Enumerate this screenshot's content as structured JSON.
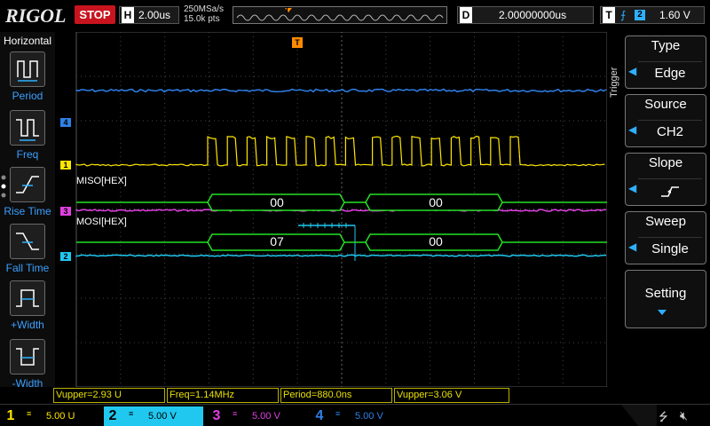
{
  "header": {
    "brand": "RIGOL",
    "run_state": "STOP",
    "timebase_label": "H",
    "timebase_value": "2.00us",
    "sample_rate": "250MSa/s",
    "memory_depth": "15.0k pts",
    "delay_label": "D",
    "delay_value": "2.00000000us",
    "trigger_label": "T",
    "trigger_channel": "2",
    "trigger_level": "1.60 V"
  },
  "left_menu": {
    "title": "Horizontal",
    "items": [
      {
        "label": "Period",
        "icon": "period-measure-icon"
      },
      {
        "label": "Freq",
        "icon": "frequency-measure-icon"
      },
      {
        "label": "Rise Time",
        "icon": "rise-time-measure-icon"
      },
      {
        "label": "Fall Time",
        "icon": "fall-time-measure-icon"
      },
      {
        "label": "+Width",
        "icon": "positive-width-measure-icon"
      },
      {
        "label": "-Width",
        "icon": "negative-width-measure-icon"
      }
    ]
  },
  "right_menu": {
    "side_label": "Trigger",
    "items": [
      {
        "head": "Type",
        "value": "Edge"
      },
      {
        "head": "Source",
        "value": "CH2"
      },
      {
        "head": "Slope",
        "value": "",
        "icon": "rising-edge-icon"
      },
      {
        "head": "Sweep",
        "value": "Single"
      },
      {
        "head": "Setting",
        "value": ""
      }
    ]
  },
  "decode": {
    "miso_label": "MISO[HEX]",
    "mosi_label": "MOSI[HEX]",
    "miso_frames": [
      "00",
      "00"
    ],
    "mosi_frames": [
      "07",
      "00"
    ]
  },
  "markers": {
    "ch4": "4",
    "ch1": "1",
    "ch3": "3",
    "ch2": "2",
    "trigger": "T"
  },
  "measurements": [
    {
      "text": "Vupper=2.93 U"
    },
    {
      "text": "Freq=1.14MHz"
    },
    {
      "text": "Period=880.0ns"
    },
    {
      "text": "Vupper=3.06 V"
    }
  ],
  "channels": [
    {
      "num": "1",
      "scale": "5.00 U",
      "color": "#ffe600"
    },
    {
      "num": "2",
      "scale": "5.00 V",
      "color": "#2fd8ff"
    },
    {
      "num": "3",
      "scale": "5.00 V",
      "color": "#e040e0"
    },
    {
      "num": "4",
      "scale": "5.00 V",
      "color": "#2080ff"
    }
  ],
  "colors": {
    "ch1": "#ffe600",
    "ch2": "#20c8f0",
    "ch3": "#e040e0",
    "ch4": "#2e80e8",
    "decode": "#22e022",
    "trigger_marker": "#ff8a00",
    "stop": "#c8141e",
    "menu_accent": "#2fb0ff"
  }
}
